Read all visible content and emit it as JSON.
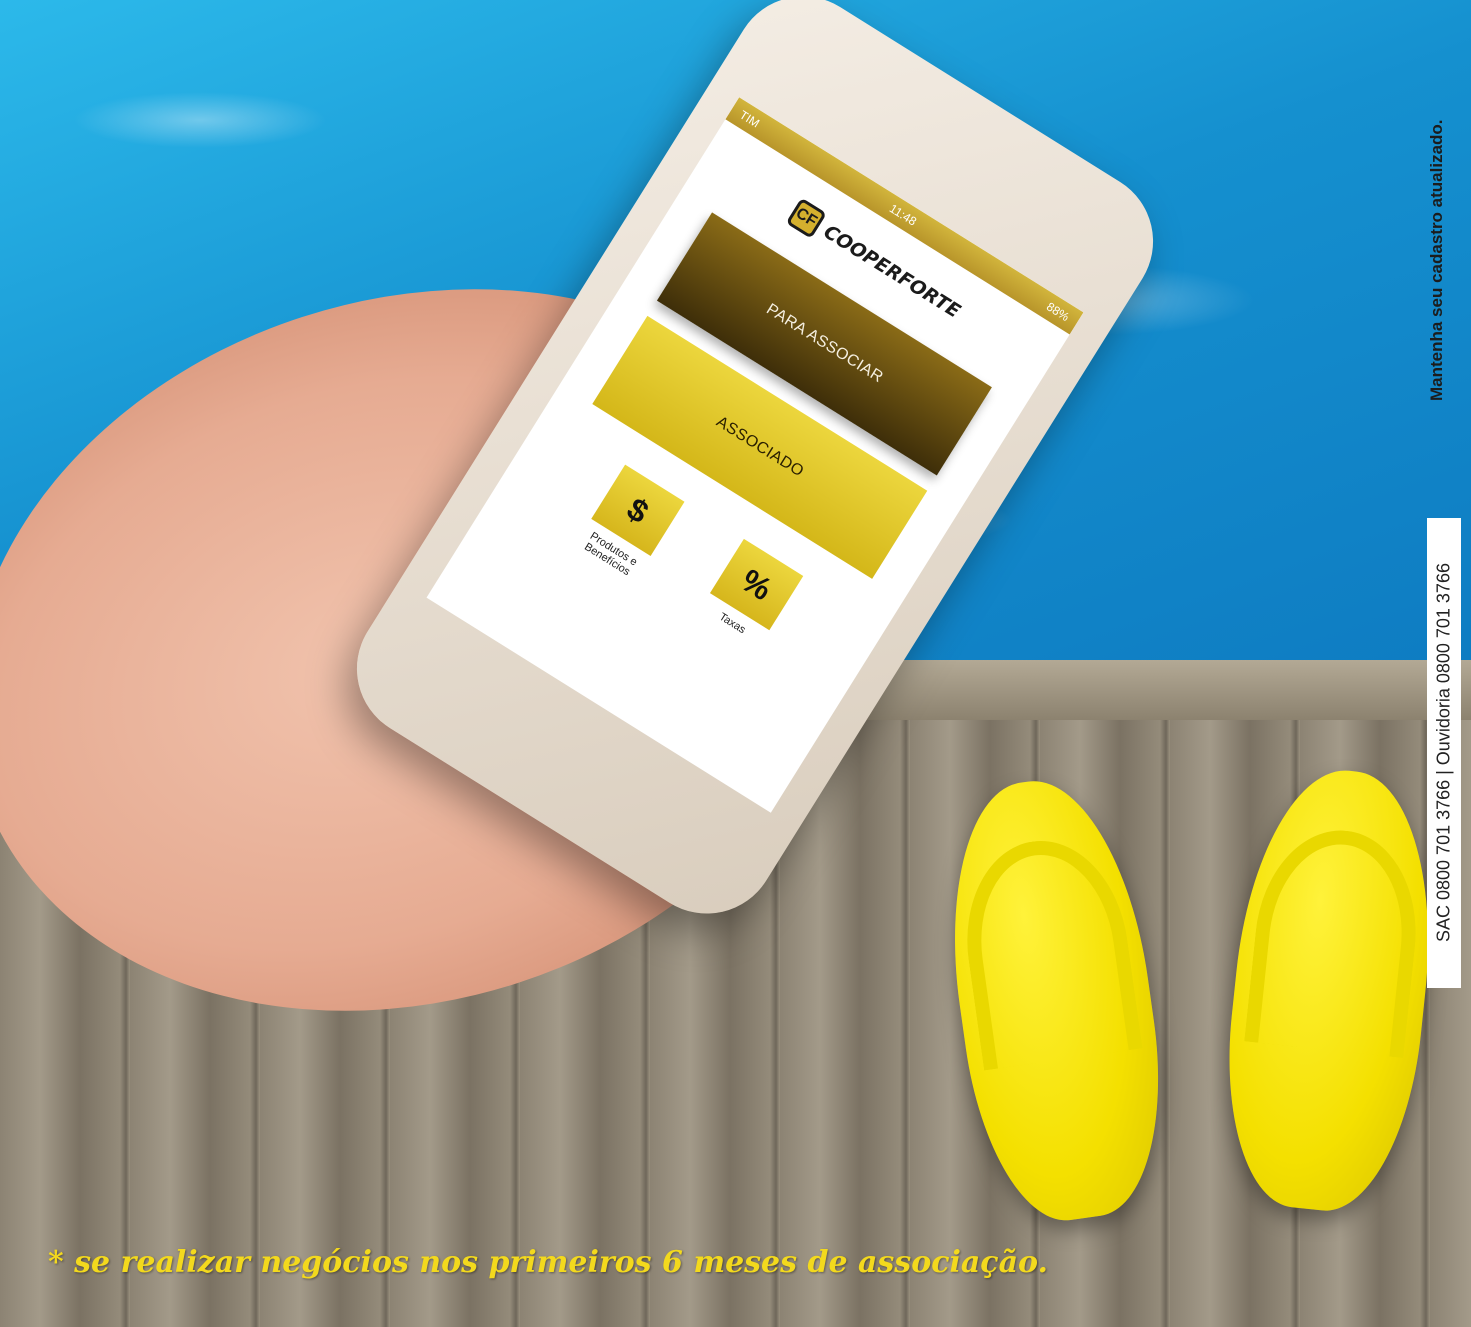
{
  "phone": {
    "status_carrier": "TIM",
    "status_time": "11:48",
    "status_battery": "88%",
    "brand_logo_text": "COOPERFORTE",
    "button_join": "PARA ASSOCIAR",
    "button_member": "ASSOCIADO",
    "tiles": [
      {
        "icon": "dollar-icon",
        "symbol": "$",
        "label": "Produtos e Benefícios"
      },
      {
        "icon": "percent-icon",
        "symbol": "%",
        "label": "Taxas"
      }
    ]
  },
  "side_message": "Mantenha seu cadastro atualizado.",
  "contact_line": "SAC 0800 701 3766 | Ouvidoria 0800 701 3766",
  "footnote": "* se realizar negócios nos primeiros 6 meses de associação.",
  "colors": {
    "gold_dark": "#5a4310",
    "gold_light": "#e4cb2c",
    "flipflop_yellow": "#f4e000",
    "footnote_yellow": "#f3d91d"
  }
}
